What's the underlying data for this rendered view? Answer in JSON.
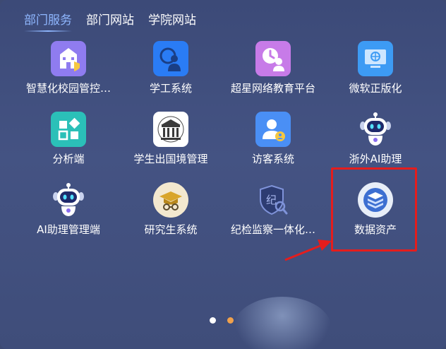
{
  "tabs": [
    {
      "label": "部门服务",
      "active": true
    },
    {
      "label": "部门网站",
      "active": false
    },
    {
      "label": "学院网站",
      "active": false
    }
  ],
  "apps": [
    {
      "label": "智慧化校园管控…",
      "icon": "campus-building-icon",
      "color": "#8f7cf0"
    },
    {
      "label": "学工系统",
      "icon": "student-work-icon",
      "color": "#2a7cf5"
    },
    {
      "label": "超星网络教育平台",
      "icon": "chaoxing-edu-icon",
      "color": "#c77be8"
    },
    {
      "label": "微软正版化",
      "icon": "microsoft-monitor-icon",
      "color": "#3d9bf4"
    },
    {
      "label": "分析端",
      "icon": "analysis-icon",
      "color": "#2bc0b8"
    },
    {
      "label": "学生出国境管理",
      "icon": "university-building-icon",
      "color": "#ffffff"
    },
    {
      "label": "访客系统",
      "icon": "visitor-icon",
      "color": "#4a8ff5"
    },
    {
      "label": "浙外AI助理",
      "icon": "robot-icon",
      "color": "#ffffff"
    },
    {
      "label": "AI助理管理端",
      "icon": "robot-icon",
      "color": "#ffffff"
    },
    {
      "label": "研究生系统",
      "icon": "graduate-icon",
      "color": "#f3e8cf"
    },
    {
      "label": "纪检监察一体化…",
      "icon": "inspection-shield-icon",
      "color": "#3a4a7e"
    },
    {
      "label": "数据资产",
      "icon": "data-stack-icon",
      "color": "#e8eef8"
    }
  ],
  "pagination": {
    "total": 2,
    "current": 2,
    "colors": {
      "inactive": "#ffffff",
      "active": "#f0a14c"
    }
  },
  "annotation": {
    "highlight_color": "#e41d1d",
    "arrow_color": "#e41d1d"
  }
}
